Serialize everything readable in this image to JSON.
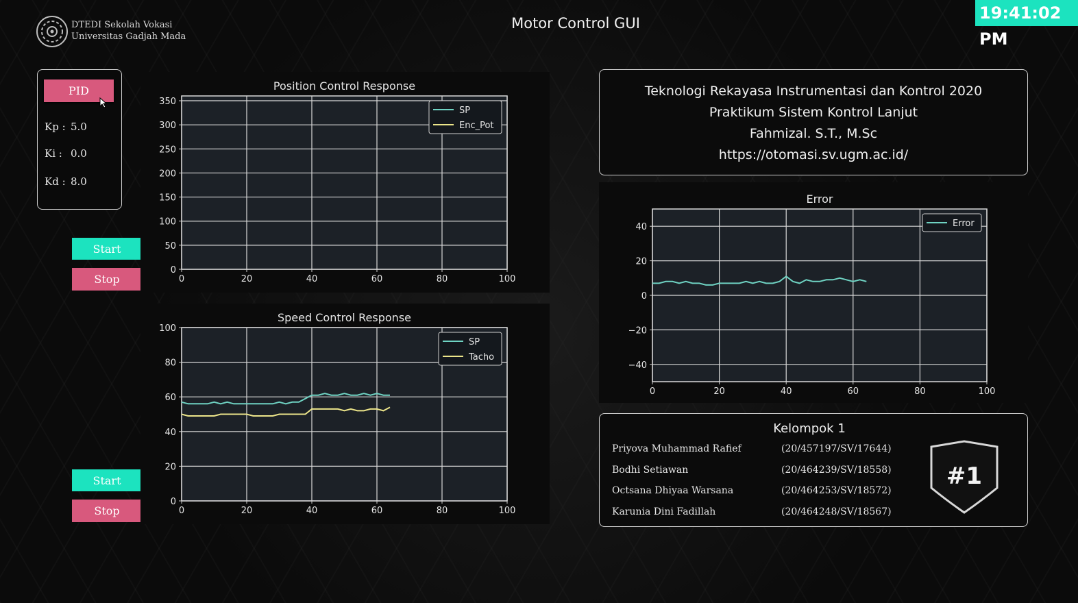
{
  "header": {
    "logo_line1": "DTEDI Sekolah Vokasi",
    "logo_line2": "Universitas Gadjah Mada",
    "title": "Motor Control GUI",
    "clock": "19:41:02 PM"
  },
  "pid_panel": {
    "mode_button": "PID",
    "kp_label": "Kp :",
    "kp_value": "5.0",
    "ki_label": "Ki  :",
    "ki_value": "0.0",
    "kd_label": "Kd :",
    "kd_value": "8.0"
  },
  "position_controls": {
    "start_label": "Start",
    "stop_label": "Stop"
  },
  "speed_controls": {
    "start_label": "Start",
    "stop_label": "Stop"
  },
  "info": {
    "line1": "Teknologi Rekayasa Instrumentasi dan Kontrol 2020",
    "line2": "Praktikum Sistem Kontrol Lanjut",
    "line3": "Fahmizal. S.T., M.Sc",
    "line4": "https://otomasi.sv.ugm.ac.id/"
  },
  "group": {
    "title": "Kelompok 1",
    "badge": "#1",
    "members": [
      {
        "name": "Priyova Muhammad Rafief",
        "nim": "(20/457197/SV/17644)"
      },
      {
        "name": "Bodhi Setiawan",
        "nim": "(20/464239/SV/18558)"
      },
      {
        "name": "Octsana Dhiyaa Warsana",
        "nim": "(20/464253/SV/18572)"
      },
      {
        "name": "Karunia Dini Fadillah",
        "nim": "(20/464248/SV/18567)"
      }
    ]
  },
  "colors": {
    "accent_cyan": "#1ce3bf",
    "accent_pink": "#d8597d",
    "sp_line": "#6fd3c3",
    "feedback_line": "#ece58a"
  },
  "chart_data": [
    {
      "id": "position",
      "type": "line",
      "title": "Position Control Response",
      "xlim": [
        0,
        100
      ],
      "ylim": [
        0,
        360
      ],
      "xticks": [
        0,
        20,
        40,
        60,
        80,
        100
      ],
      "yticks": [
        0,
        50,
        100,
        150,
        200,
        250,
        300,
        350
      ],
      "grid": true,
      "legend_position": "top-right",
      "series": [
        {
          "name": "SP",
          "color": "#6fd3c3",
          "x": [],
          "y": []
        },
        {
          "name": "Enc_Pot",
          "color": "#ece58a",
          "x": [],
          "y": []
        }
      ]
    },
    {
      "id": "speed",
      "type": "line",
      "title": "Speed Control Response",
      "xlim": [
        0,
        100
      ],
      "ylim": [
        0,
        100
      ],
      "xticks": [
        0,
        20,
        40,
        60,
        80,
        100
      ],
      "yticks": [
        0,
        20,
        40,
        60,
        80,
        100
      ],
      "grid": true,
      "legend_position": "top-right",
      "series": [
        {
          "name": "SP",
          "color": "#6fd3c3",
          "x": [
            0,
            2,
            4,
            6,
            8,
            10,
            12,
            14,
            16,
            18,
            20,
            22,
            24,
            26,
            28,
            30,
            32,
            34,
            36,
            38,
            40,
            42,
            44,
            46,
            48,
            50,
            52,
            54,
            56,
            58,
            60,
            62,
            64
          ],
          "y": [
            57,
            56,
            56,
            56,
            56,
            57,
            56,
            57,
            56,
            56,
            56,
            56,
            56,
            56,
            56,
            57,
            56,
            57,
            57,
            59,
            61,
            61,
            62,
            61,
            61,
            62,
            61,
            61,
            62,
            61,
            62,
            61,
            61
          ]
        },
        {
          "name": "Tacho",
          "color": "#ece58a",
          "x": [
            0,
            2,
            4,
            6,
            8,
            10,
            12,
            14,
            16,
            18,
            20,
            22,
            24,
            26,
            28,
            30,
            32,
            34,
            36,
            38,
            40,
            42,
            44,
            46,
            48,
            50,
            52,
            54,
            56,
            58,
            60,
            62,
            64
          ],
          "y": [
            50,
            49,
            49,
            49,
            49,
            49,
            50,
            50,
            50,
            50,
            50,
            49,
            49,
            49,
            49,
            50,
            50,
            50,
            50,
            50,
            53,
            53,
            53,
            53,
            53,
            52,
            53,
            52,
            52,
            53,
            53,
            52,
            54
          ]
        }
      ]
    },
    {
      "id": "error",
      "type": "line",
      "title": "Error",
      "xlim": [
        0,
        100
      ],
      "ylim": [
        -50,
        50
      ],
      "xticks": [
        0,
        20,
        40,
        60,
        80,
        100
      ],
      "yticks": [
        -40,
        -20,
        0,
        20,
        40
      ],
      "grid": true,
      "legend_position": "top-right",
      "series": [
        {
          "name": "Error",
          "color": "#6fd3c3",
          "x": [
            0,
            2,
            4,
            6,
            8,
            10,
            12,
            14,
            16,
            18,
            20,
            22,
            24,
            26,
            28,
            30,
            32,
            34,
            36,
            38,
            40,
            42,
            44,
            46,
            48,
            50,
            52,
            54,
            56,
            58,
            60,
            62,
            64
          ],
          "y": [
            7,
            7,
            8,
            8,
            7,
            8,
            7,
            7,
            6,
            6,
            7,
            7,
            7,
            7,
            8,
            7,
            8,
            7,
            7,
            8,
            11,
            8,
            7,
            9,
            8,
            8,
            9,
            9,
            10,
            9,
            8,
            9,
            8
          ]
        }
      ]
    }
  ]
}
